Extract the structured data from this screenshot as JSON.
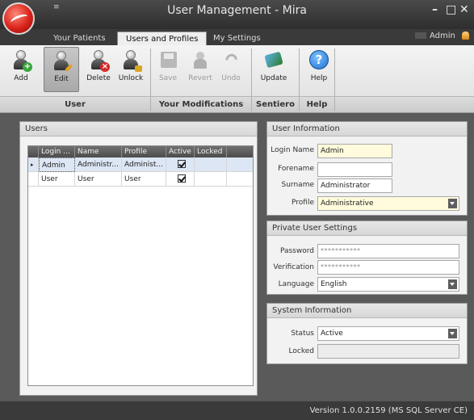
{
  "window": {
    "title": "User Management - Mira",
    "quick_access": "≡",
    "minimize": "–",
    "maximize": "□",
    "close": "✕"
  },
  "tabs": [
    {
      "label": "Your Patients",
      "active": false
    },
    {
      "label": "Users and Profiles",
      "active": true
    },
    {
      "label": "My Settings",
      "active": false
    }
  ],
  "current_user": "Admin",
  "ribbon": {
    "buttons": [
      {
        "label": "Add",
        "icon": "add-user-icon",
        "enabled": true
      },
      {
        "label": "Edit",
        "icon": "edit-user-icon",
        "enabled": true,
        "selected": true
      },
      {
        "label": "Delete",
        "icon": "delete-user-icon",
        "enabled": true
      },
      {
        "label": "Unlock",
        "icon": "unlock-user-icon",
        "enabled": true
      },
      {
        "label": "Save",
        "icon": "save-icon",
        "enabled": false
      },
      {
        "label": "Revert",
        "icon": "revert-icon",
        "enabled": false
      },
      {
        "label": "Undo",
        "icon": "undo-icon",
        "enabled": false
      },
      {
        "label": "Update",
        "icon": "update-icon",
        "enabled": true
      },
      {
        "label": "Help",
        "icon": "help-icon",
        "enabled": true
      }
    ],
    "groups": [
      "User",
      "Your Modifications",
      "Sentiero",
      "Help"
    ]
  },
  "users_panel": {
    "title": "Users",
    "columns": [
      "Login ...",
      "Name",
      "Profile",
      "Active",
      "Locked"
    ],
    "rows": [
      {
        "login": "Admin",
        "name": "Administr...",
        "profile": "Administ...",
        "active": true,
        "locked": false,
        "selected": true
      },
      {
        "login": "User",
        "name": "User",
        "profile": "User",
        "active": true,
        "locked": false,
        "selected": false
      }
    ]
  },
  "user_info": {
    "title": "User Information",
    "login_label": "Login Name",
    "login_value": "Admin",
    "forename_label": "Forename",
    "forename_value": "",
    "surname_label": "Surname",
    "surname_value": "Administrator",
    "profile_label": "Profile",
    "profile_value": "Administrative"
  },
  "private_settings": {
    "title": "Private User Settings",
    "password_label": "Password",
    "password_value": "***********",
    "verification_label": "Verification",
    "verification_value": "***********",
    "language_label": "Language",
    "language_value": "English"
  },
  "system_info": {
    "title": "System Information",
    "status_label": "Status",
    "status_value": "Active",
    "locked_label": "Locked",
    "locked_value": ""
  },
  "status_bar": {
    "version": "Version 1.0.0.2159 (MS SQL Server CE)"
  },
  "colors": {
    "required_field": "#fffbdc",
    "selected_row": "#dce6f4",
    "help_blue": "#1e6fd0"
  }
}
